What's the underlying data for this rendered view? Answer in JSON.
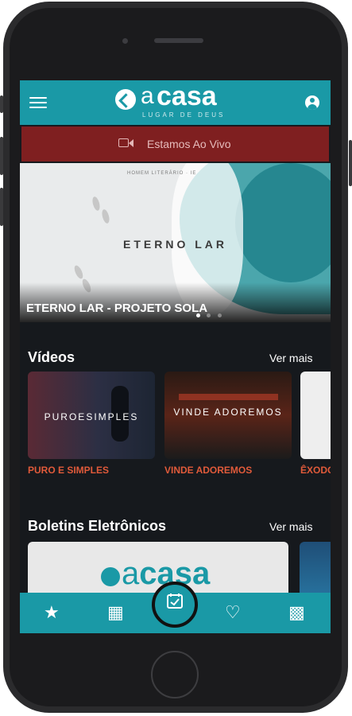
{
  "app": {
    "brand_prefix": "a",
    "brand_name": "casa",
    "brand_tagline": "LUGAR DE DEUS"
  },
  "live_banner": {
    "label": "Estamos Ao Vivo"
  },
  "hero": {
    "small_text": "HOMEM LITERÁRIO · IE",
    "center_title": "ETERNO LAR",
    "caption": "ETERNO LAR - PROJETO SOLA"
  },
  "videos": {
    "title": "Vídeos",
    "see_more": "Ver mais",
    "items": [
      {
        "title": "PURO E SIMPLES",
        "overlay": "PUROESIMPLES"
      },
      {
        "title": "VINDE ADOREMOS",
        "overlay": "VINDE ADOREMOS"
      },
      {
        "title": "ÊXODO",
        "overlay": ""
      }
    ]
  },
  "boletins": {
    "title": "Boletins Eletrônicos",
    "see_more": "Ver mais",
    "logo_prefix": "a",
    "logo_name": "casa"
  },
  "bottom_nav": {
    "items": [
      {
        "icon": "star-icon"
      },
      {
        "icon": "building-icon"
      },
      {
        "icon": "calendar-check-icon"
      },
      {
        "icon": "hand-heart-icon"
      },
      {
        "icon": "qr-code-icon"
      }
    ]
  },
  "colors": {
    "teal": "#1a99a6",
    "live_red": "#7f1f20",
    "card_title_orange": "#e05a3a",
    "background": "#16191d"
  }
}
